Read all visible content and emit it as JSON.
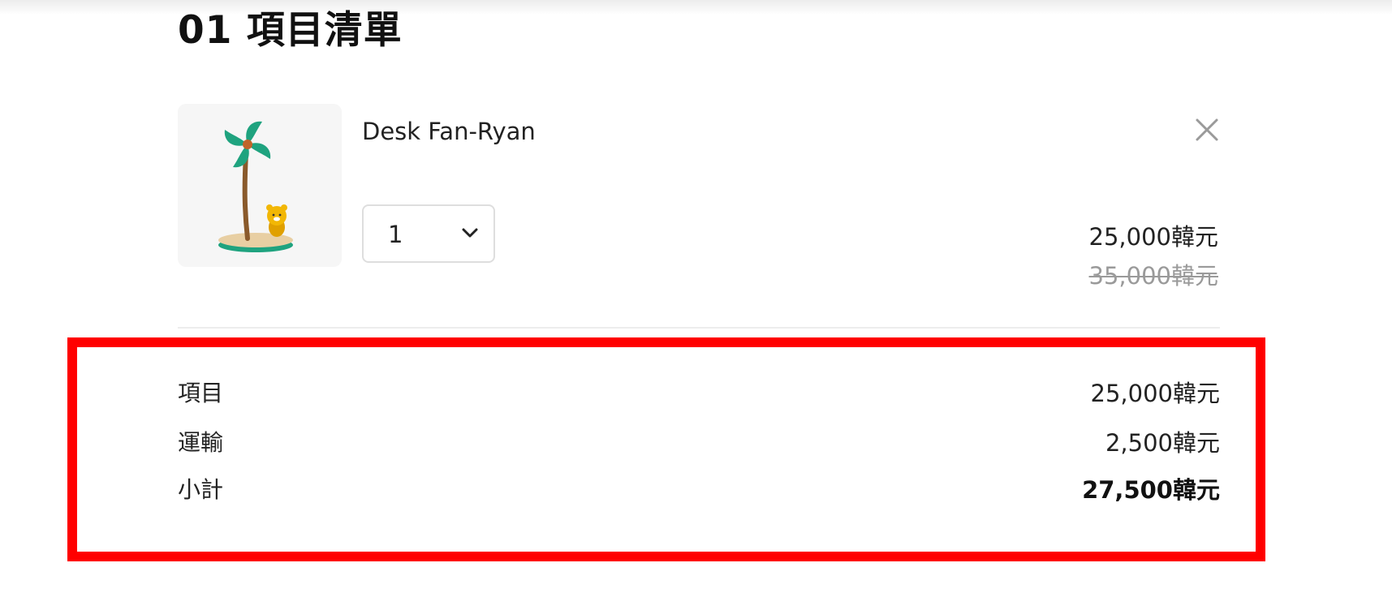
{
  "cart": {
    "title": "01 項目清單",
    "item": {
      "name": "Desk Fan-Ryan",
      "image_icon": "desk-fan-palm-tree-illustration",
      "quantity": "1",
      "price": "25,000韓元",
      "original_price": "35,000韓元",
      "remove_icon": "close-icon"
    },
    "summary": {
      "rows": [
        {
          "label": "項目",
          "value": "25,000韓元"
        },
        {
          "label": "運輸",
          "value": "2,500韓元"
        },
        {
          "label": "小計",
          "value": "27,500韓元"
        }
      ]
    },
    "colors": {
      "highlight": "#ff0000",
      "leaf_green": "#1fa37f",
      "trunk_brown": "#8a5a2b",
      "character_yellow": "#f2b705",
      "strikethrough_gray": "#9a9a9a"
    }
  }
}
